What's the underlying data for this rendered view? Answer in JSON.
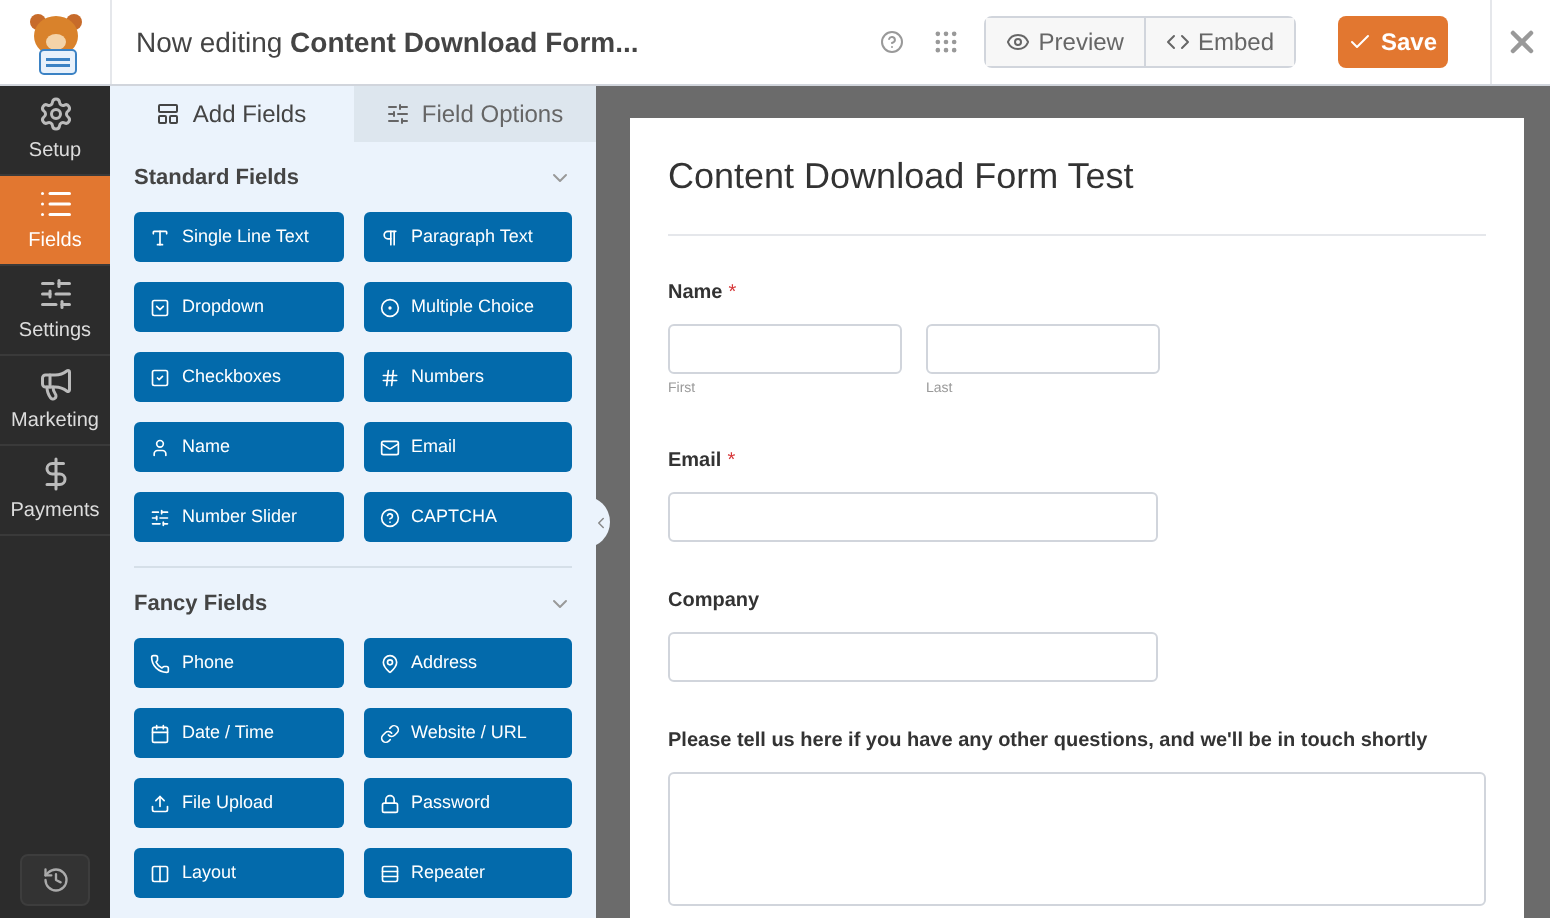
{
  "header": {
    "prefix": "Now editing",
    "form_name": "Content Download Form...",
    "buttons": [
      {
        "label": "Preview",
        "kind": "preview"
      },
      {
        "label": "Embed",
        "kind": "embed"
      }
    ],
    "save": "Save"
  },
  "sidebar": {
    "items": [
      {
        "label": "Setup",
        "kind": "gear",
        "selected": false
      },
      {
        "label": "Fields",
        "kind": "list",
        "selected": true
      },
      {
        "label": "Settings",
        "kind": "sliders",
        "selected": false
      },
      {
        "label": "Marketing",
        "kind": "megaphone",
        "selected": false
      },
      {
        "label": "Payments",
        "kind": "dollar",
        "selected": false
      }
    ]
  },
  "panel": {
    "tabs": [
      {
        "label": "Add Fields",
        "kind": "layout",
        "selected": true
      },
      {
        "label": "Field Options",
        "kind": "sliders",
        "selected": false
      }
    ],
    "sections": [
      {
        "title": "Standard Fields",
        "expanded": true,
        "fields": [
          {
            "label": "Single Line Text",
            "kind": "text"
          },
          {
            "label": "Paragraph Text",
            "kind": "pilcrow"
          },
          {
            "label": "Dropdown",
            "kind": "dropdown"
          },
          {
            "label": "Multiple Choice",
            "kind": "radio"
          },
          {
            "label": "Checkboxes",
            "kind": "check"
          },
          {
            "label": "Numbers",
            "kind": "hash"
          },
          {
            "label": "Name",
            "kind": "user"
          },
          {
            "label": "Email",
            "kind": "mail"
          },
          {
            "label": "Number Slider",
            "kind": "sliders"
          },
          {
            "label": "CAPTCHA",
            "kind": "help"
          }
        ]
      },
      {
        "title": "Fancy Fields",
        "expanded": true,
        "fields": [
          {
            "label": "Phone",
            "kind": "phone"
          },
          {
            "label": "Address",
            "kind": "pin"
          },
          {
            "label": "Date / Time",
            "kind": "calendar"
          },
          {
            "label": "Website / URL",
            "kind": "link"
          },
          {
            "label": "File Upload",
            "kind": "upload"
          },
          {
            "label": "Password",
            "kind": "lock"
          },
          {
            "label": "Layout",
            "kind": "columns"
          },
          {
            "label": "Repeater",
            "kind": "rows"
          }
        ]
      }
    ]
  },
  "form": {
    "title": "Content Download Form Test",
    "fields": [
      {
        "kind": "name",
        "label": "Name",
        "required_mark": "*",
        "sublabels": [
          "First",
          "Last"
        ]
      },
      {
        "kind": "text",
        "label": "Email",
        "required_mark": "*"
      },
      {
        "kind": "text",
        "label": "Company"
      },
      {
        "kind": "textarea",
        "label": "Please tell us here if you have any other questions, and we'll be in touch shortly"
      }
    ]
  }
}
